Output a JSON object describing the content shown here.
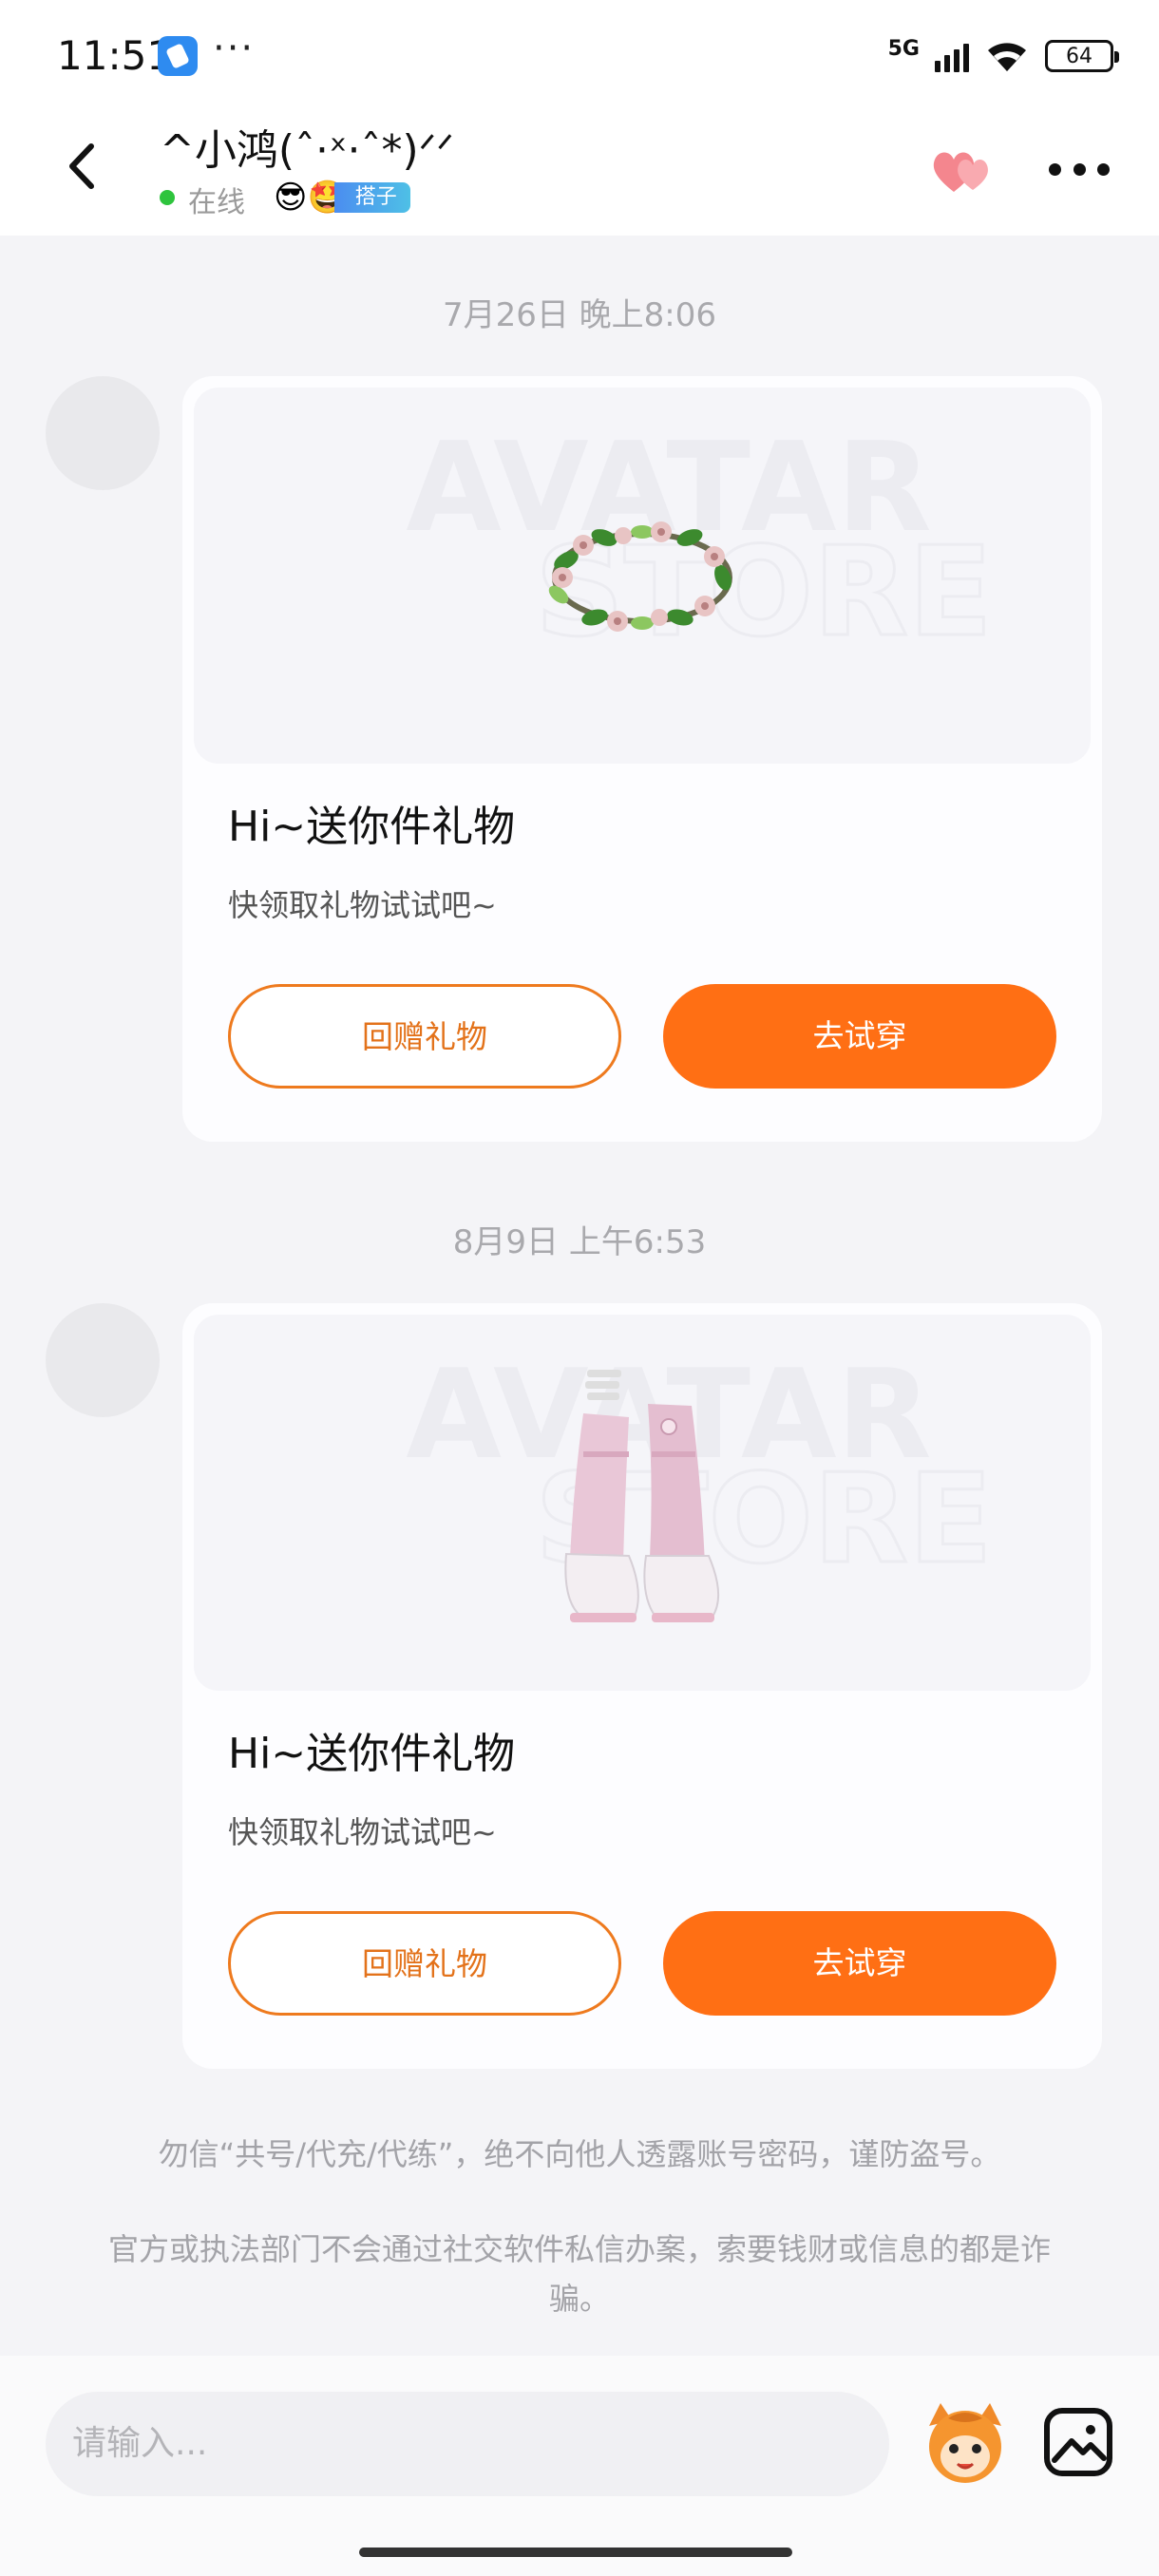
{
  "status_bar": {
    "time": "11:51",
    "dots": "···",
    "network": "5G",
    "battery": "64"
  },
  "header": {
    "name": "^小鸿(ˆ·ˣ·ˆ*)ᐟᐟ",
    "online_status": "在线",
    "badge_emoji": "😎🤩",
    "badge_label": "搭子"
  },
  "messages": [
    {
      "timestamp": "7月26日 晚上8:06",
      "gift_title": "Hi~送你件礼物",
      "gift_subtitle": "快领取礼物试试吧~",
      "return_label": "回赠礼物",
      "try_label": "去试穿",
      "image_subject": "flower-wreath"
    },
    {
      "timestamp": "8月9日 上午6:53",
      "gift_title": "Hi~送你件礼物",
      "gift_subtitle": "快领取礼物试试吧~",
      "return_label": "回赠礼物",
      "try_label": "去试穿",
      "image_subject": "pink-leg-warmer-shoes"
    }
  ],
  "watermark_text": [
    "AVATAR",
    "STORE"
  ],
  "notices": [
    "勿信“共号/代充/代练”，绝不向他人透露账号密码，谨防盗号。",
    "官方或执法部门不会通过社交软件私信办案，索要钱财或信息的都是诈骗。"
  ],
  "input": {
    "placeholder": "请输入..."
  },
  "colors": {
    "accent": "#ff6f14",
    "accent_border": "#ee7a1e",
    "online": "#2ec43d",
    "badge": "#4b8df0"
  }
}
